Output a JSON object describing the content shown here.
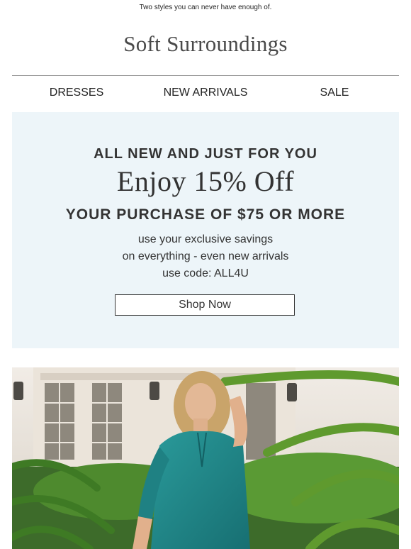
{
  "preheader": "Two styles you can never have enough of.",
  "brand": {
    "logo_text": "Soft Surroundings"
  },
  "nav": {
    "items": [
      "DRESSES",
      "NEW ARRIVALS",
      "SALE"
    ]
  },
  "promo": {
    "eyebrow": "ALL NEW AND JUST FOR YOU",
    "headline": "Enjoy 15% Off",
    "subheadline": "YOUR PURCHASE OF $75 OR MORE",
    "lines": [
      "use your exclusive savings",
      "on everything - even new arrivals",
      "use code: ALL4U"
    ],
    "cta_label": "Shop Now",
    "background_color": "#edf5f9"
  },
  "hero": {
    "description_icon": "model-photo",
    "top_color": "#e8e0d6",
    "foliage_color": "#4e8a2e",
    "garment_color": "#1e8a8a"
  }
}
